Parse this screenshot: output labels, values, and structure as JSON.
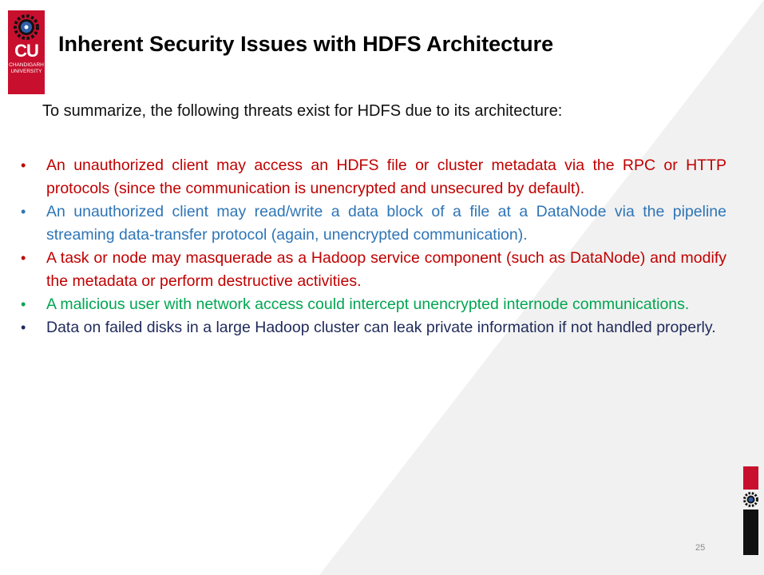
{
  "logo": {
    "abbr": "CU",
    "line1": "CHANDIGARH",
    "line2": "UNIVERSITY"
  },
  "slide": {
    "title": "Inherent Security Issues with HDFS Architecture",
    "intro": "To summarize, the following threats exist for HDFS due to its architecture:",
    "bullets": [
      {
        "text": "An unauthorized client may access an HDFS file or cluster metadata via the RPC or HTTP protocols (since the communication is unencrypted and unsecured by default).",
        "color": "#c00000"
      },
      {
        "text": "An unauthorized client may read/write a data block of a file at a DataNode via the pipeline streaming data-transfer protocol (again, unencrypted communication).",
        "color": "#2e75b6"
      },
      {
        "text": "A task or node may masquerade as a Hadoop service component (such as DataNode) and modify the metadata or perform destructive activities.",
        "color": "#c00000"
      },
      {
        "text": "A malicious user with network access could intercept unencrypted internode communications.",
        "color": "#00a651"
      },
      {
        "text": "Data on failed disks in a large Hadoop cluster can leak private information if not handled properly.",
        "color": "#1f2a5a"
      }
    ],
    "bullet_symbol": "•",
    "page_number": "25"
  },
  "colors": {
    "brand_red": "#c8102e",
    "dark": "#111111"
  }
}
